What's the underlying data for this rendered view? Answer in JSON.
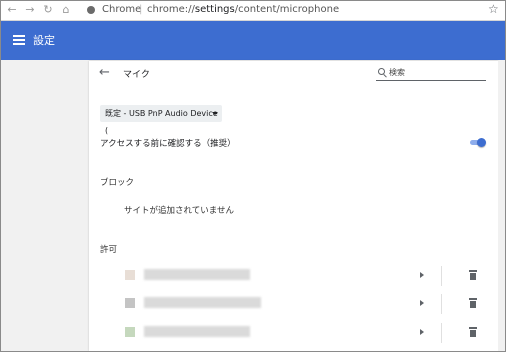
{
  "browser": {
    "chrome_label": "Chrome",
    "separator": "|",
    "url_prefix": "chrome://",
    "url_host": "settings",
    "url_path": "/content/microphone",
    "nav": {
      "back": "←",
      "forward": "→",
      "reload": "↻",
      "home": "⌂"
    },
    "star": "☆",
    "icons": [
      "back-icon",
      "forward-icon",
      "reload-icon",
      "home-icon",
      "info-icon",
      "star-icon"
    ]
  },
  "header": {
    "title": "設定",
    "menu_icon": "hamburger-menu-icon",
    "color": "#3d6dd0"
  },
  "page": {
    "back_arrow": "←",
    "title": "マイク",
    "search_placeholder": "検索",
    "device_select": "既定 - USB PnP Audio Device (",
    "ask_before_access": "アクセスする前に確認する（推奨）",
    "ask_toggle_on": true,
    "block": {
      "label": "ブロック",
      "empty_message": "サイトが追加されていません"
    },
    "allow": {
      "label": "許可",
      "sites": [
        {
          "favicon_color": "#e8ded6",
          "name": ""
        },
        {
          "favicon_color": "#c4c4c4",
          "name": ""
        },
        {
          "favicon_color": "#c5d8bd",
          "name": ""
        }
      ]
    }
  }
}
